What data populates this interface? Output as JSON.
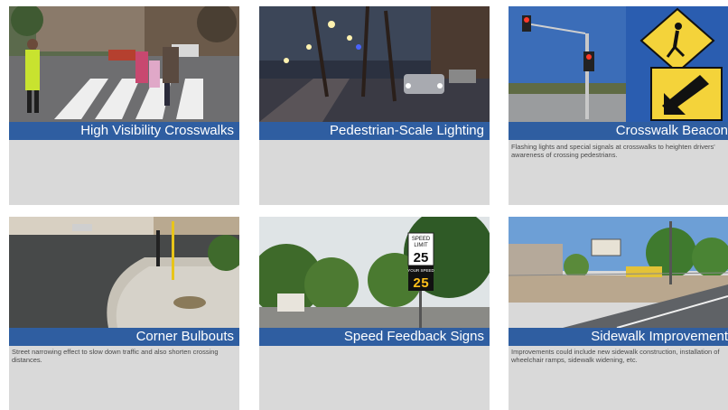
{
  "cards": [
    {
      "title": "High Visibility Crosswalks",
      "description": "",
      "image": "crosswalk-photo"
    },
    {
      "title": "Pedestrian-Scale Lighting",
      "description": "",
      "image": "street-lighting-photo"
    },
    {
      "title": "Crosswalk Beacon",
      "description": "Flashing lights and special signals at crosswalks to heighten drivers' awareness of crossing pedestrians.",
      "image": "crosswalk-beacon-photo"
    },
    {
      "title": "Corner Bulbouts",
      "description": "Street narrowing effect to slow down traffic and also shorten crossing distances.",
      "image": "corner-bulbout-photo"
    },
    {
      "title": "Speed Feedback Signs",
      "description": "",
      "image": "speed-sign-photo",
      "sign": {
        "top": "SPEED",
        "mid": "LIMIT",
        "limit": "25",
        "your": "YOUR SPEED",
        "speed": "25"
      }
    },
    {
      "title": "Sidewalk Improvement",
      "description": "Improvements could include new sidewalk construction, installation of wheelchair ramps, sidewalk widening, etc.",
      "image": "sidewalk-photo"
    }
  ],
  "colors": {
    "banner": "#2f5ea1",
    "card_background": "#d9d9d9"
  }
}
